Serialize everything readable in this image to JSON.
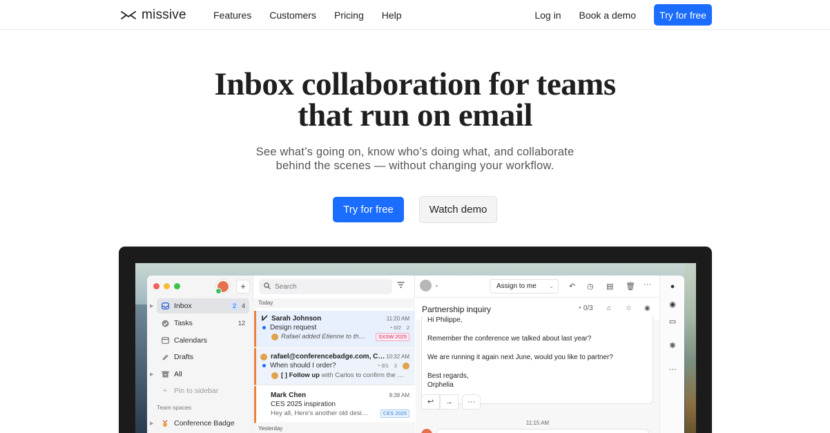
{
  "nav": {
    "logo_text": "missive",
    "links": [
      "Features",
      "Customers",
      "Pricing",
      "Help"
    ],
    "login": "Log in",
    "book_demo": "Book a demo",
    "try_free": "Try for free",
    "accent_color": "#1a6dff"
  },
  "hero": {
    "title_line1": "Inbox collaboration for teams",
    "title_line2": "that run on email",
    "subtitle_line1": "See what’s going on, know who’s doing what, and collaborate",
    "subtitle_line2": "behind the scenes — without changing your workflow.",
    "cta_primary": "Try for free",
    "cta_secondary": "Watch demo"
  },
  "app": {
    "sidebar": {
      "items": [
        {
          "label": "Inbox",
          "icon": "inbox-icon",
          "count_badge": "2",
          "count": "4"
        },
        {
          "label": "Tasks",
          "icon": "check-circle-icon",
          "count": "12"
        },
        {
          "label": "Calendars",
          "icon": "calendar-icon"
        },
        {
          "label": "Drafts",
          "icon": "pencil-icon"
        },
        {
          "label": "All",
          "icon": "archive-icon"
        }
      ],
      "pin": "Pin to sidebar",
      "section": "Team spaces",
      "team_item": "Conference Badge"
    },
    "list": {
      "search_placeholder": "Search",
      "today": "Today",
      "yesterday": "Yesterday",
      "conversations": [
        {
          "from": "Sarah Johnson",
          "time": "11:20 AM",
          "subject": "Design request",
          "tasks": "0/2",
          "replies": "2",
          "preview_italic": "Rafael added Etienne to th…",
          "tag": "SXSW 2025"
        },
        {
          "from": "rafael@conferencebadge.com, C…",
          "time": "10:32 AM",
          "subject": "When should I order?",
          "tasks": "0/1",
          "replies": "2",
          "preview_bold": "[ ] Follow up",
          "preview_rest": " with Carlos to confirm the …"
        },
        {
          "from": "Mark Chen",
          "time": "8:38 AM",
          "subject": "CES 2025 inspiration",
          "preview": "Hey all, Here's another old desi…",
          "tag": "CES 2025"
        }
      ]
    },
    "detail": {
      "assign": "Assign to me",
      "subject": "Partnership inquiry",
      "tasks": "0/3",
      "greeting": "Hi Philippe,",
      "line1": "Remember the conference we talked about last year?",
      "line2": "We are running it again next June, would you like to partner?",
      "sign1": "Best regards,",
      "sign2": "Orphelia",
      "timestamp": "11:15 AM"
    }
  }
}
